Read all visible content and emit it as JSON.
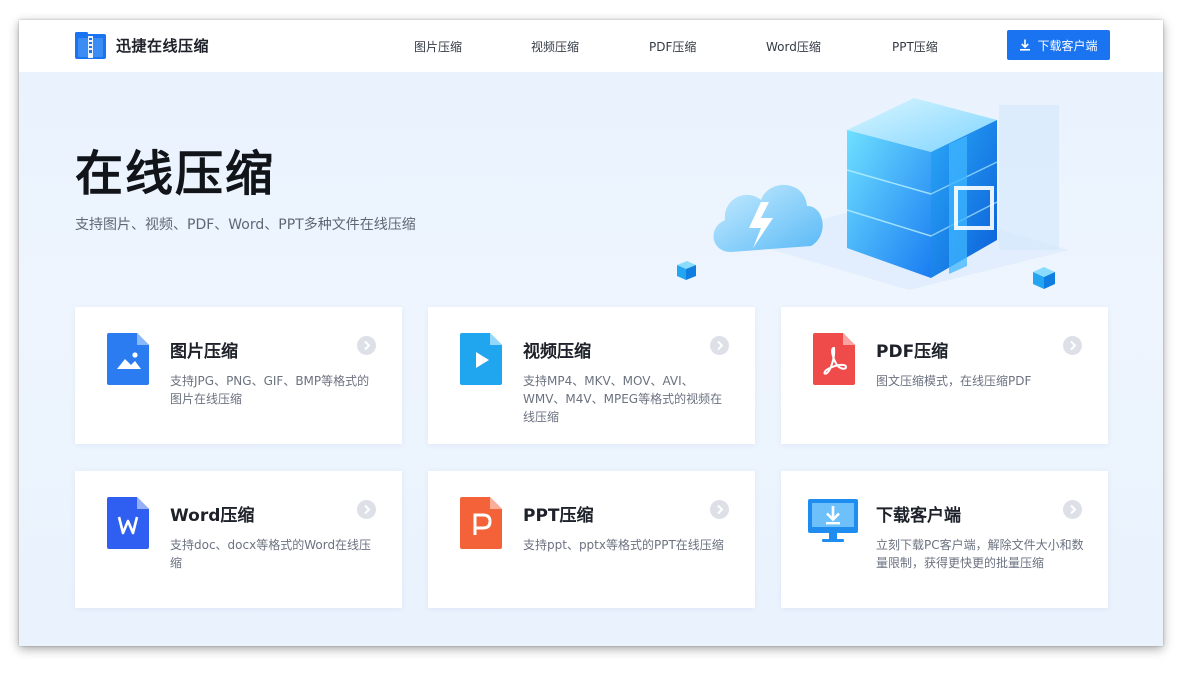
{
  "header": {
    "brand": "迅捷在线压缩",
    "nav": [
      "图片压缩",
      "视频压缩",
      "PDF压缩",
      "Word压缩",
      "PPT压缩"
    ],
    "download_label": "下载客户端"
  },
  "hero": {
    "title": "在线压缩",
    "subtitle": "支持图片、视频、PDF、Word、PPT多种文件在线压缩"
  },
  "cards": [
    {
      "title": "图片压缩",
      "desc": "支持JPG、PNG、GIF、BMP等格式的图片在线压缩",
      "icon": "image-file-icon",
      "color": "#2b7cf0"
    },
    {
      "title": "视频压缩",
      "desc": "支持MP4、MKV、MOV、AVI、WMV、M4V、MPEG等格式的视频在线压缩",
      "icon": "video-file-icon",
      "color": "#1fa6ee"
    },
    {
      "title": "PDF压缩",
      "desc": "图文压缩模式，在线压缩PDF",
      "icon": "pdf-file-icon",
      "color": "#ef4b4b"
    },
    {
      "title": "Word压缩",
      "desc": "支持doc、docx等格式的Word在线压缩",
      "icon": "word-file-icon",
      "color": "#2f5ff0"
    },
    {
      "title": "PPT压缩",
      "desc": "支持ppt、pptx等格式的PPT在线压缩",
      "icon": "ppt-file-icon",
      "color": "#f4623a"
    },
    {
      "title": "下载客户端",
      "desc": "立刻下载PC客户端，解除文件大小和数量限制，获得更快更的批量压缩",
      "icon": "monitor-download-icon",
      "color": "#1f8df0"
    }
  ],
  "colors": {
    "accent": "#1a73f0",
    "title": "#1d2129",
    "muted": "#6b7280"
  }
}
